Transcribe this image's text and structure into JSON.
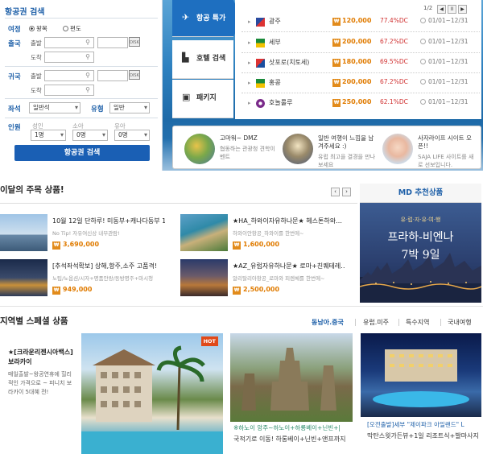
{
  "search": {
    "title": "항공권 검색",
    "trip_label": "여정",
    "roundtrip": "왕복",
    "oneway": "편도",
    "depart_label": "출국",
    "return_label": "귀국",
    "from": "출발",
    "to": "도착",
    "seat_label": "좌석",
    "seat_value": "일반석",
    "type_label": "유형",
    "type_value": "일반",
    "people_label": "인원",
    "adult": "성인",
    "child": "소아",
    "infant": "유아",
    "adult_value": "1명",
    "child_value": "0명",
    "infant_value": "0명",
    "button": "항공권 검색",
    "cal_label": "DISK"
  },
  "tabs": [
    {
      "label": "항공 특가"
    },
    {
      "label": "호텔 검색"
    },
    {
      "label": "패키지"
    }
  ],
  "pager": {
    "text": "1/2",
    "prev": "◀",
    "pause": "II",
    "next": "▶"
  },
  "deals": [
    {
      "city": "광주",
      "price": "120,000",
      "dc": "77.4%DC",
      "date": "01/01~12/31"
    },
    {
      "city": "세부",
      "price": "200,000",
      "dc": "67.2%DC",
      "date": "01/01~12/31"
    },
    {
      "city": "삿포로(치토세)",
      "price": "180,000",
      "dc": "69.5%DC",
      "date": "01/01~12/31"
    },
    {
      "city": "홍콩",
      "price": "200,000",
      "dc": "67.2%DC",
      "date": "01/01~12/31"
    },
    {
      "city": "호놀룰루",
      "price": "250,000",
      "dc": "62.1%DC",
      "date": "01/01~12/31"
    }
  ],
  "won_icon": "₩",
  "promos": [
    {
      "title": "고마워~ DMZ",
      "sub": "협동하는 관광청 견학이벤트"
    },
    {
      "title": "일반 여행이 느낌을 남겨주세요 :)",
      "sub": "유럽 최고을 결경을 만나 보세요"
    },
    {
      "title": "사자라이프 시이트 오픈!!",
      "sub": "SAJA LIFE 사이트를 새로 선보입니다."
    }
  ],
  "featured": {
    "heading": "이달의 주목 상품!",
    "prev": "‹",
    "next": "›",
    "items": [
      {
        "title": "10월 12일 단하루! 미동부+캐나다동부 1…",
        "sub": "No Tip! 자유여신상 내부관람!",
        "price": "3,690,000"
      },
      {
        "title": "★HA_하와이자유하나문★ 헤스톤하와…",
        "sub": "하와이안항공_하와이를 한번에~",
        "price": "1,600,000"
      },
      {
        "title": "[추석좌석확보] 상해,항주,소주 고품격!",
        "sub": "노팁/노옵션/시자+명품안랑/동방명주+마시청",
        "price": "949,000"
      },
      {
        "title": "★AZ_유럽자유하나문★ 로마+친퀘테레…",
        "sub": "알리탈리아항공_로마와 피렌체를 한번에~",
        "price": "2,500,000"
      }
    ]
  },
  "md": {
    "heading": "MD 추천상품",
    "tag": "유·럽·자·유·여·행",
    "line1": "프라하-비엔나",
    "line2": "7박 9일"
  },
  "region": {
    "heading": "지역별 스페셜 상품",
    "tabs": [
      "동남아.중국",
      "유럽.미주",
      "특수지역",
      "국내여행"
    ],
    "left_title": "★[크라운리젠시아백스] 보라카이",
    "left_sub": "매일출발~왕공연휴에 힐리적인 가격으로 ~ 피니치 보라카이 5대혜 전!",
    "hot": "HOT",
    "card2_title": "※하노이 앙주~하노이+하룡베이+닌빈+|",
    "card2_sub": "국적기로 이동! 하롱베이+닌빈+앤프까지",
    "card3_title": "[오전출발]세부 \"제이파크 아일랜드\" L",
    "card3_sub": "막탄스윗가든뷰+1일 리조트식+발마사지"
  },
  "colors": {
    "accent": "#1e6fc0",
    "price": "#e07b00",
    "discount": "#d03030"
  }
}
